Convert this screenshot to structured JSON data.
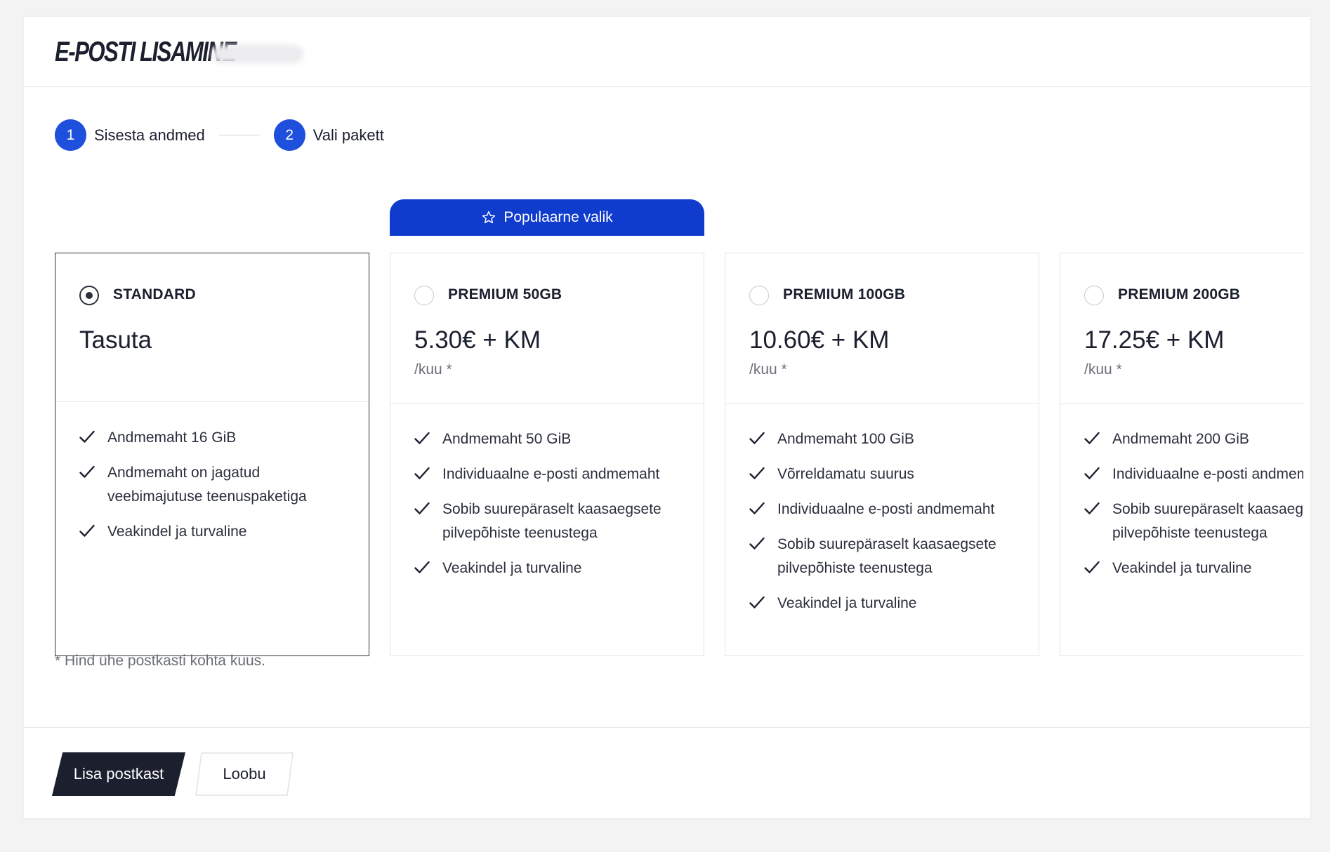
{
  "header": {
    "title": "E-POSTI LISAMINE"
  },
  "steps": [
    {
      "number": "1",
      "label": "Sisesta andmed"
    },
    {
      "number": "2",
      "label": "Vali pakett"
    }
  ],
  "popular_label": "Populaarne valik",
  "plans": [
    {
      "name": "STANDARD",
      "price": "Tasuta",
      "period": "",
      "selected": true,
      "features": [
        "Andmemaht 16 GiB",
        "Andmemaht on jagatud",
        "veebimajutuse teenuspaketiga",
        "Veakindel ja turvaline"
      ]
    },
    {
      "name": "PREMIUM 50GB",
      "price": "5.30€ + KM",
      "period": "/kuu *",
      "selected": false,
      "features": [
        "Andmemaht 50 GiB",
        "Individuaalne e-posti andmemaht",
        "Sobib suurepäraselt kaasaegsete",
        "pilvepõhiste teenustega",
        "Veakindel ja turvaline"
      ]
    },
    {
      "name": "PREMIUM 100GB",
      "price": "10.60€ + KM",
      "period": "/kuu *",
      "selected": false,
      "features": [
        "Andmemaht 100 GiB",
        "Võrreldamatu suurus",
        "Individuaalne e-posti andmemaht",
        "Sobib suurepäraselt kaasaegsete",
        "pilvepõhiste teenustega",
        "Veakindel ja turvaline"
      ]
    },
    {
      "name": "PREMIUM 200GB",
      "price": "17.25€ + KM",
      "period": "/kuu *",
      "selected": false,
      "features": [
        "Andmemaht 200 GiB",
        "Individuaalne e-posti andmemaht",
        "Sobib suurepäraselt kaasaegsete",
        "pilvepõhiste teenustega",
        "Veakindel ja turvaline"
      ]
    }
  ],
  "footnote": "* Hind ühe postkasti kohta kuus.",
  "actions": {
    "primary_label": "Lisa postkast",
    "secondary_label": "Loobu"
  },
  "colors": {
    "accent": "#1f4fdd",
    "popular": "#0f3ccd",
    "dark": "#1b1f2e"
  }
}
